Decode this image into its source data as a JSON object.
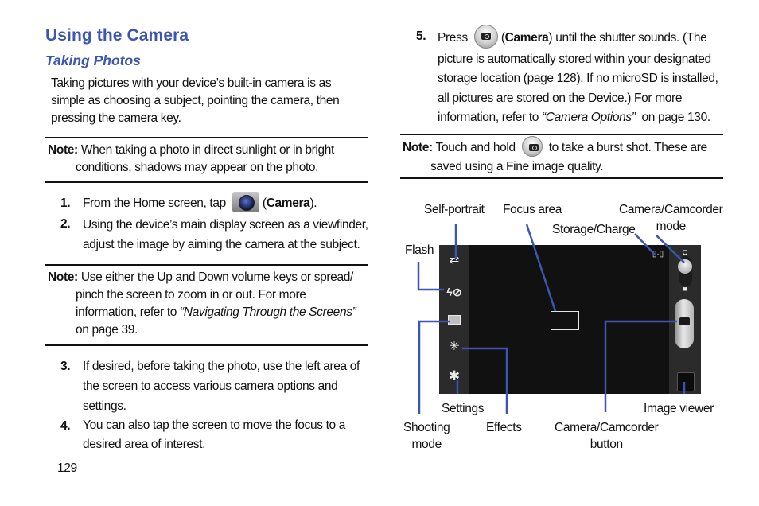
{
  "page": {
    "title": "Using the Camera",
    "subtitle": "Taking Photos",
    "intro": [
      "Taking pictures with your device’s built-in camera is as",
      "simple as choosing a subject, pointing the camera, then",
      "pressing the camera key."
    ],
    "page_number": "129"
  },
  "notes": [
    {
      "label": "Note:",
      "lines": [
        "When taking a photo in direct sunlight or in bright",
        "conditions, shadows may appear on the photo."
      ]
    },
    {
      "label": "Note:",
      "lines": [
        "Use either the Up and Down volume keys or spread/",
        "pinch the screen to zoom in or out. For more",
        "information, refer to ",
        "on page 39."
      ],
      "link": "“Navigating Through the Screens”"
    },
    {
      "label": "Note:",
      "lines": [
        "Touch and hold ",
        " to take a burst shot. These are",
        "saved using a Fine image quality."
      ],
      "icon": "shutter-button-icon"
    }
  ],
  "steps": [
    {
      "num": "1.",
      "pre": "From the Home screen, tap ",
      "icon": "camera-app-icon",
      "bold": "Camera",
      "post": ")."
    },
    {
      "num": "2.",
      "lines": [
        "Using the device’s main display screen as a viewfinder,",
        "adjust the image by aiming the camera at the subject."
      ]
    },
    {
      "num": "3.",
      "lines": [
        "If desired, before taking the photo, use the left area of",
        "the screen to access various camera options and",
        "settings."
      ]
    },
    {
      "num": "4.",
      "lines": [
        "You can also tap the screen to move the focus to a",
        "desired area of interest."
      ]
    },
    {
      "num": "5.",
      "pre": "Press ",
      "icon": "shutter-button-icon",
      "bold": "Camera",
      "post": ") until the shutter sounds. (The",
      "lines": [
        "picture is automatically stored within your designated",
        "storage location (page 128). If no microSD is installed,",
        "all pictures are stored on the Device.) For more",
        "information, refer to "
      ],
      "link": "“Camera Options”",
      "link_post": "on page 130."
    }
  ],
  "diagram": {
    "labels": {
      "self_portrait": "Self-portrait",
      "focus_area": "Focus area",
      "camera_mode_1": "Camera/Camcorder",
      "camera_mode_2": "mode",
      "storage": "Storage/Charge",
      "flash": "Flash",
      "settings": "Settings",
      "image_viewer": "Image viewer",
      "shooting_1": "Shooting",
      "shooting_2": "mode",
      "effects": "Effects",
      "cam_button_1": "Camera/Camcorder",
      "cam_button_2": "button"
    },
    "icons": {
      "self_portrait": "⇄",
      "flash": "ϟ⊘",
      "shooting": "▭",
      "effects": "✳",
      "settings": "✱",
      "camera_small": "◘",
      "camcorder_small": "■",
      "storage": "▯·▯"
    },
    "leader_color": "#3c55b3"
  }
}
